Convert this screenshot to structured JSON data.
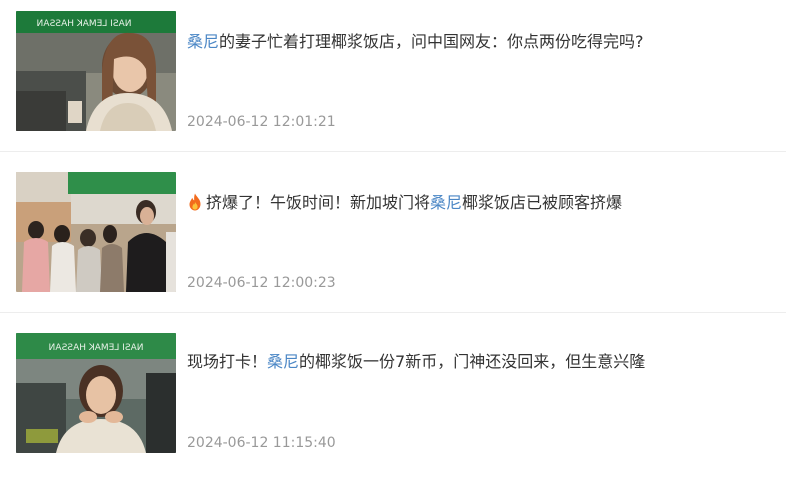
{
  "feed": {
    "items": [
      {
        "title_highlight": "桑尼",
        "title_rest": "的妻子忙着打理椰浆饭店，问中国网友：你点两份吃得完吗?",
        "timestamp": "2024-06-12 12:01:21",
        "thumbnail_icon": "woman-in-restaurant-thumbnail",
        "sign_text": "NASI LEMAK HASSAN"
      },
      {
        "title_prefix_icon": "fire-icon",
        "title_before": "挤爆了！午饭时间！新加坡门将",
        "title_highlight": "桑尼",
        "title_after": "椰浆饭店已被顾客挤爆",
        "timestamp": "2024-06-12 12:00:23",
        "thumbnail_icon": "crowded-restaurant-thumbnail"
      },
      {
        "title_before": "现场打卡！",
        "title_highlight": "桑尼",
        "title_after": "的椰浆饭一份7新币，门神还没回来，但生意兴隆",
        "timestamp": "2024-06-12 11:15:40",
        "thumbnail_icon": "woman-eating-thumbnail",
        "sign_text": "NASI LEMAK HASSAN"
      }
    ],
    "colors": {
      "highlight": "#4a86c5",
      "title_text": "#333333",
      "timestamp_text": "#999999",
      "divider": "#ededed"
    }
  }
}
